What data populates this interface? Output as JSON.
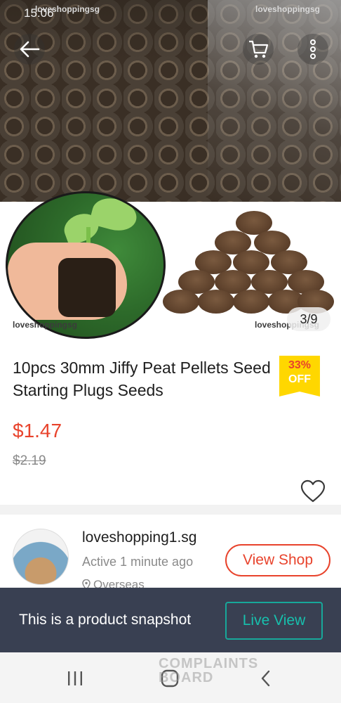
{
  "status_bar": {
    "time": "15:06"
  },
  "watermarks": {
    "top_left": "loveshoppingsg",
    "top_right": "loveshoppingsg",
    "left": "loveshoppingsg",
    "right": "loveshoppingsg"
  },
  "header": {
    "back_icon": "arrow-left-icon",
    "cart_icon": "cart-icon",
    "more_icon": "more-vertical-icon"
  },
  "gallery": {
    "counter": "3/9"
  },
  "product": {
    "title": "10pcs 30mm Jiffy Peat Pellets Seed Starting Plugs Seeds",
    "discount_pct": "33%",
    "discount_off": "OFF",
    "price": "$1.47",
    "original_price": "$2.19",
    "wishlist_icon": "heart-outline-icon"
  },
  "shop": {
    "name": "loveshopping1.sg",
    "active_status": "Active 1 minute ago",
    "location": "Overseas",
    "location_icon": "location-pin-icon",
    "view_shop_label": "View Shop"
  },
  "snapshot_bar": {
    "message": "This is a product snapshot",
    "live_view_label": "Live View"
  },
  "nav_bar": {
    "recent_icon": "recent-apps-icon",
    "home_icon": "home-icon",
    "back_icon": "back-chevron-icon"
  },
  "overlay_logo": {
    "line1": "COMPLAINTS",
    "line2": "BOARD"
  },
  "colors": {
    "accent": "#e8432c",
    "badge": "#ffd700",
    "snapshot_bg": "#394052",
    "live_view": "#17c0ad"
  }
}
